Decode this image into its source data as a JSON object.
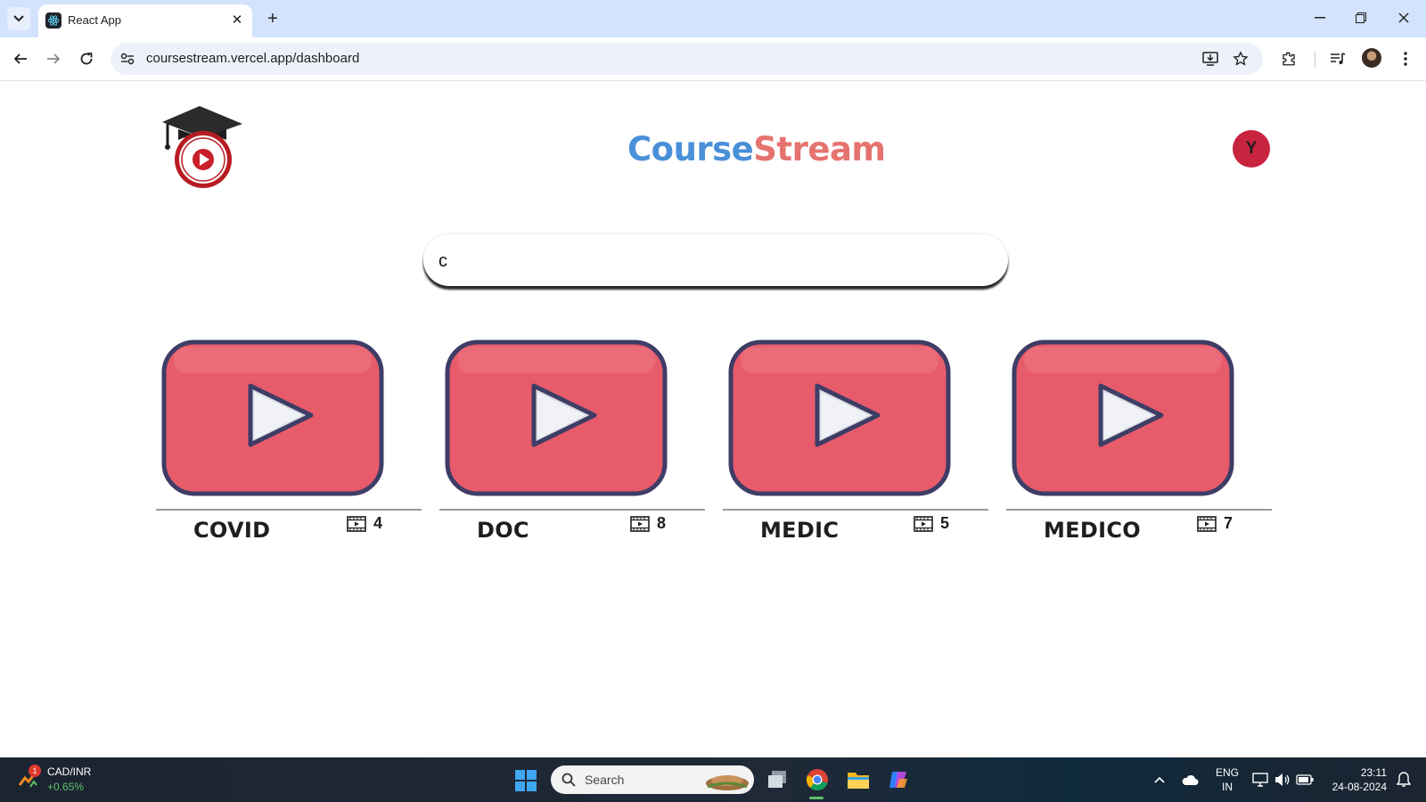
{
  "browser": {
    "tab_title": "React App",
    "tab_close": "✕",
    "new_tab": "+",
    "url": "coursestream.vercel.app/dashboard"
  },
  "header": {
    "brand_part1": "Course",
    "brand_part2": "Stream",
    "avatar_initial": "Y"
  },
  "search": {
    "value": "c",
    "placeholder": ""
  },
  "courses": [
    {
      "title": "COVID",
      "video_count": "4"
    },
    {
      "title": "DOC",
      "video_count": "8"
    },
    {
      "title": "MEDIC",
      "video_count": "5"
    },
    {
      "title": "MEDICO",
      "video_count": "7"
    }
  ],
  "colors": {
    "brand_blue": "#4a90d9",
    "brand_salmon": "#e5736f",
    "avatar_red": "#c8243f",
    "thumb_red": "#e85b6b",
    "thumb_outline": "#3e3d66"
  },
  "taskbar": {
    "ticker_badge": "1",
    "ticker_name": "CAD/INR",
    "ticker_change": "+0.65%",
    "search_label": "Search",
    "lang_line1": "ENG",
    "lang_line2": "IN",
    "time": "23:11",
    "date": "24-08-2024"
  }
}
